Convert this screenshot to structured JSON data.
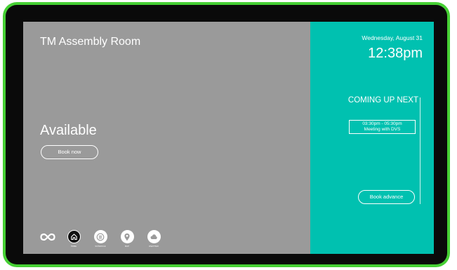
{
  "room": {
    "name": "TM Assembly Room",
    "status": "Available",
    "book_now_label": "Book now"
  },
  "clock": {
    "date": "Wednesday, August 31",
    "time": "12:38pm"
  },
  "upcoming": {
    "title": "COMING UP NEXT",
    "events": [
      {
        "time_range": "03:30pm - 05:30pm",
        "title": "Meeting with DVS"
      }
    ],
    "book_advance_label": "Book advance"
  },
  "nav": {
    "items": [
      {
        "label": "HOME",
        "icon": "home-icon",
        "active": true
      },
      {
        "label": "SCHEDULE",
        "icon": "schedule-icon",
        "active": false
      },
      {
        "label": "MAP",
        "icon": "map-pin-icon",
        "active": false
      },
      {
        "label": "WEATHER",
        "icon": "weather-icon",
        "active": false
      }
    ]
  },
  "colors": {
    "device_frame": "#46d034",
    "left_panel": "#9a9a9a",
    "right_panel": "#00c1b0",
    "text": "#ffffff"
  }
}
